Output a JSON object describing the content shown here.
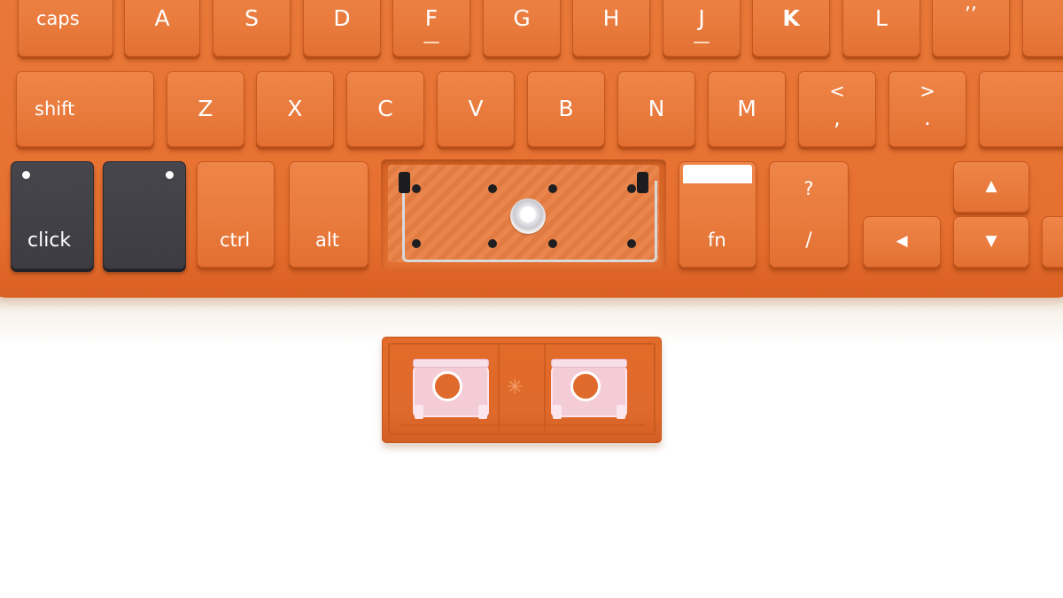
{
  "colors": {
    "keyboard_orange": "#e87a3c",
    "dark_key": "#3c3c42",
    "legend_white": "#ffffff",
    "stabilizer_pink": "#f3ccd8"
  },
  "keys": {
    "caps": "caps",
    "a": "A",
    "s": "S",
    "d": "D",
    "f": "F",
    "g": "G",
    "h": "H",
    "j": "J",
    "k": "K",
    "l": "L",
    "quote": ",,",
    "shift": "shift",
    "z": "Z",
    "x": "X",
    "c": "C",
    "v": "V",
    "b": "B",
    "n": "N",
    "m": "M",
    "comma_top": "<",
    "comma_bottom": ",",
    "period_top": ">",
    "period_bottom": ".",
    "click": "click",
    "ctrl": "ctrl",
    "alt": "alt",
    "fn": "fn",
    "slash_top": "?",
    "slash_bottom": "/",
    "arrow_up": "▲",
    "arrow_left": "◀",
    "arrow_down": "▼"
  }
}
